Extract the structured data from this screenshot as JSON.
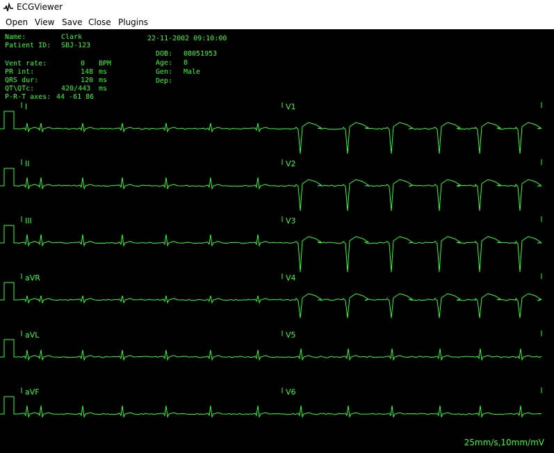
{
  "window": {
    "title": "ECGViewer"
  },
  "menu": [
    "Open",
    "View",
    "Save",
    "Close",
    "Plugins"
  ],
  "patient": {
    "name_label": "Name:",
    "name": "Clark",
    "id_label": "Patient ID:",
    "id": "SBJ-123",
    "datetime": "22-11-2002 09:10:00",
    "dob_label": "DOB:",
    "dob": "08051953",
    "age_label": "Age:",
    "age": "0",
    "gender_label": "Gen:",
    "gender": "Male",
    "dep_label": "Dep:",
    "dep": ""
  },
  "measurements": [
    {
      "label": "Vent rate:",
      "value": "0",
      "unit": "BPM"
    },
    {
      "label": "PR int:",
      "value": "148",
      "unit": "ms"
    },
    {
      "label": "QRS dur:",
      "value": "120",
      "unit": "ms"
    },
    {
      "label": "QT\\QTc:",
      "value": "420/443",
      "unit": "ms"
    },
    {
      "label": "P-R-T axes:",
      "value": "44 -61 86",
      "unit": ""
    }
  ],
  "leads_left": [
    "I",
    "II",
    "III",
    "aVR",
    "aVL",
    "aVF"
  ],
  "leads_right": [
    "V1",
    "V2",
    "V3",
    "V4",
    "V5",
    "V6"
  ],
  "scale": "25mm/s,10mm/mV",
  "colors": {
    "trace": "#33ff33",
    "background": "#000000"
  }
}
